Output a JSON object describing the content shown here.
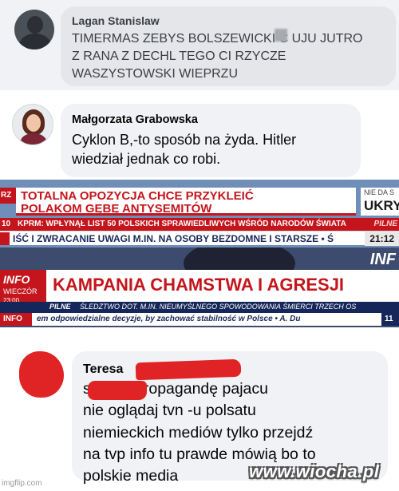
{
  "comments": [
    {
      "author": "Lagan Stanislaw",
      "text": "TIMERMAS ZEBYS BOLSZEWICKI C   UJU JUTRO\nZ RANA Z DECHL TEGO CI RZYCZE\nWASZYSTOWSKI WIEPRZU"
    },
    {
      "author": "Małgorzata Grabowska",
      "text": "Cyklon B,-to sposób na żyda. Hitler\nwiedział jednak co robi."
    },
    {
      "author": "Teresa",
      "text": "            siejesz propagandę pajacu\nnie oglądaj tvn -u polsatu\nniemieckich mediów tylko przejdź\nna tvp info tu prawde mówią bo to\npolskie media"
    }
  ],
  "tv_screens": [
    {
      "left_tab": "RZ",
      "headline": "TOTALNA OPOZYCJA CHCE PRZYKLEIĆ POLAKOM GĘBĘ ANTYSEMITÓW",
      "right_top": "NIE DA S",
      "right_big": "UKRY",
      "strip_num": "10",
      "strip_text": "KPRM: WPŁYNĄŁ LIST 50 POLSKICH SPRAWIEDLIWYCH WŚRÓD NARODÓW ŚWIATA",
      "strip_right": "PILNE",
      "ticker": "IŚĆ I ZWRACANIE UWAGI M.IN. NA OSOBY BEZDOMNE I STARSZE • Ś",
      "clock": "21:12"
    },
    {
      "logo": "INFO",
      "sub": "WIECZÓR",
      "time": "23:00",
      "top_right": "INF",
      "headline": "KAMPANIA CHAMSTWA I AGRESJI",
      "strip_label": "PILNE",
      "strip_text": "ŚLEDZTWO DOT. M.IN. NIEUMYŚLNEGO SPOWODOWANIA ŚMIERCI TRZECH OS",
      "ticker_badge": "INFO",
      "ticker": "em odpowiedzialne decyzje, by zachować stabilność w Polsce • A. Du",
      "clock": "11"
    }
  ],
  "watermarks": {
    "left": "imgflip.com",
    "right": "www.wiocha.pl"
  },
  "colors": {
    "tvp_red": "#c4151c",
    "censor_red": "#e02426",
    "navy": "#14265a"
  }
}
